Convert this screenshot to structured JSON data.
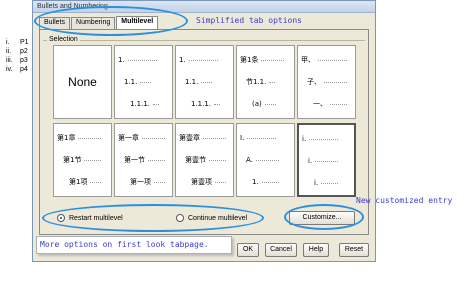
{
  "document_list": [
    {
      "num": "i.",
      "text": "P1"
    },
    {
      "num": "ii.",
      "text": "p2"
    },
    {
      "num": "iii.",
      "text": "p3"
    },
    {
      "num": "iv.",
      "text": "p4"
    }
  ],
  "dialog": {
    "title": "Bullets and Numbering",
    "tabs": [
      {
        "label": "Bullets",
        "active": false
      },
      {
        "label": "Numbering",
        "active": false
      },
      {
        "label": "Multilevel",
        "active": true
      }
    ],
    "group_label": "Selection",
    "presets": [
      {
        "type": "none",
        "label": "None"
      },
      {
        "type": "levels",
        "lines": [
          "1.",
          "1.1.",
          "1.1.1."
        ]
      },
      {
        "type": "levels",
        "lines": [
          "1.",
          "1.1.",
          "1.1.1."
        ]
      },
      {
        "type": "levels",
        "lines": [
          "第1条",
          "节1.1.",
          "(a)"
        ]
      },
      {
        "type": "levels",
        "lines": [
          "甲、",
          "子、",
          "一、"
        ]
      },
      {
        "type": "levels",
        "lines": [
          "第1章",
          "第1节",
          "第1项"
        ]
      },
      {
        "type": "levels",
        "lines": [
          "第一章",
          "第一节",
          "第一项"
        ]
      },
      {
        "type": "levels",
        "lines": [
          "第壹章",
          "第壹节",
          "第壹项"
        ]
      },
      {
        "type": "levels",
        "lines": [
          "I.",
          "A.",
          "1."
        ]
      },
      {
        "type": "levels",
        "lines": [
          "i.",
          "i.",
          "i."
        ],
        "selected": true
      }
    ],
    "restart_option": "Restart multilevel",
    "continue_option": "Continue multilevel",
    "restart_selected": true,
    "customize_label": "Customize...",
    "buttons": {
      "ok": "OK",
      "cancel": "Cancel",
      "help": "Help",
      "reset": "Reset"
    }
  },
  "annotations": {
    "tabs_note": "Simplified tab options",
    "customize_note": "New customized entry",
    "more_options_note": "More options on first look tabpage."
  },
  "colors": {
    "annotation_text": "#3b3bd4",
    "highlight_oval": "#2d8fe0"
  }
}
